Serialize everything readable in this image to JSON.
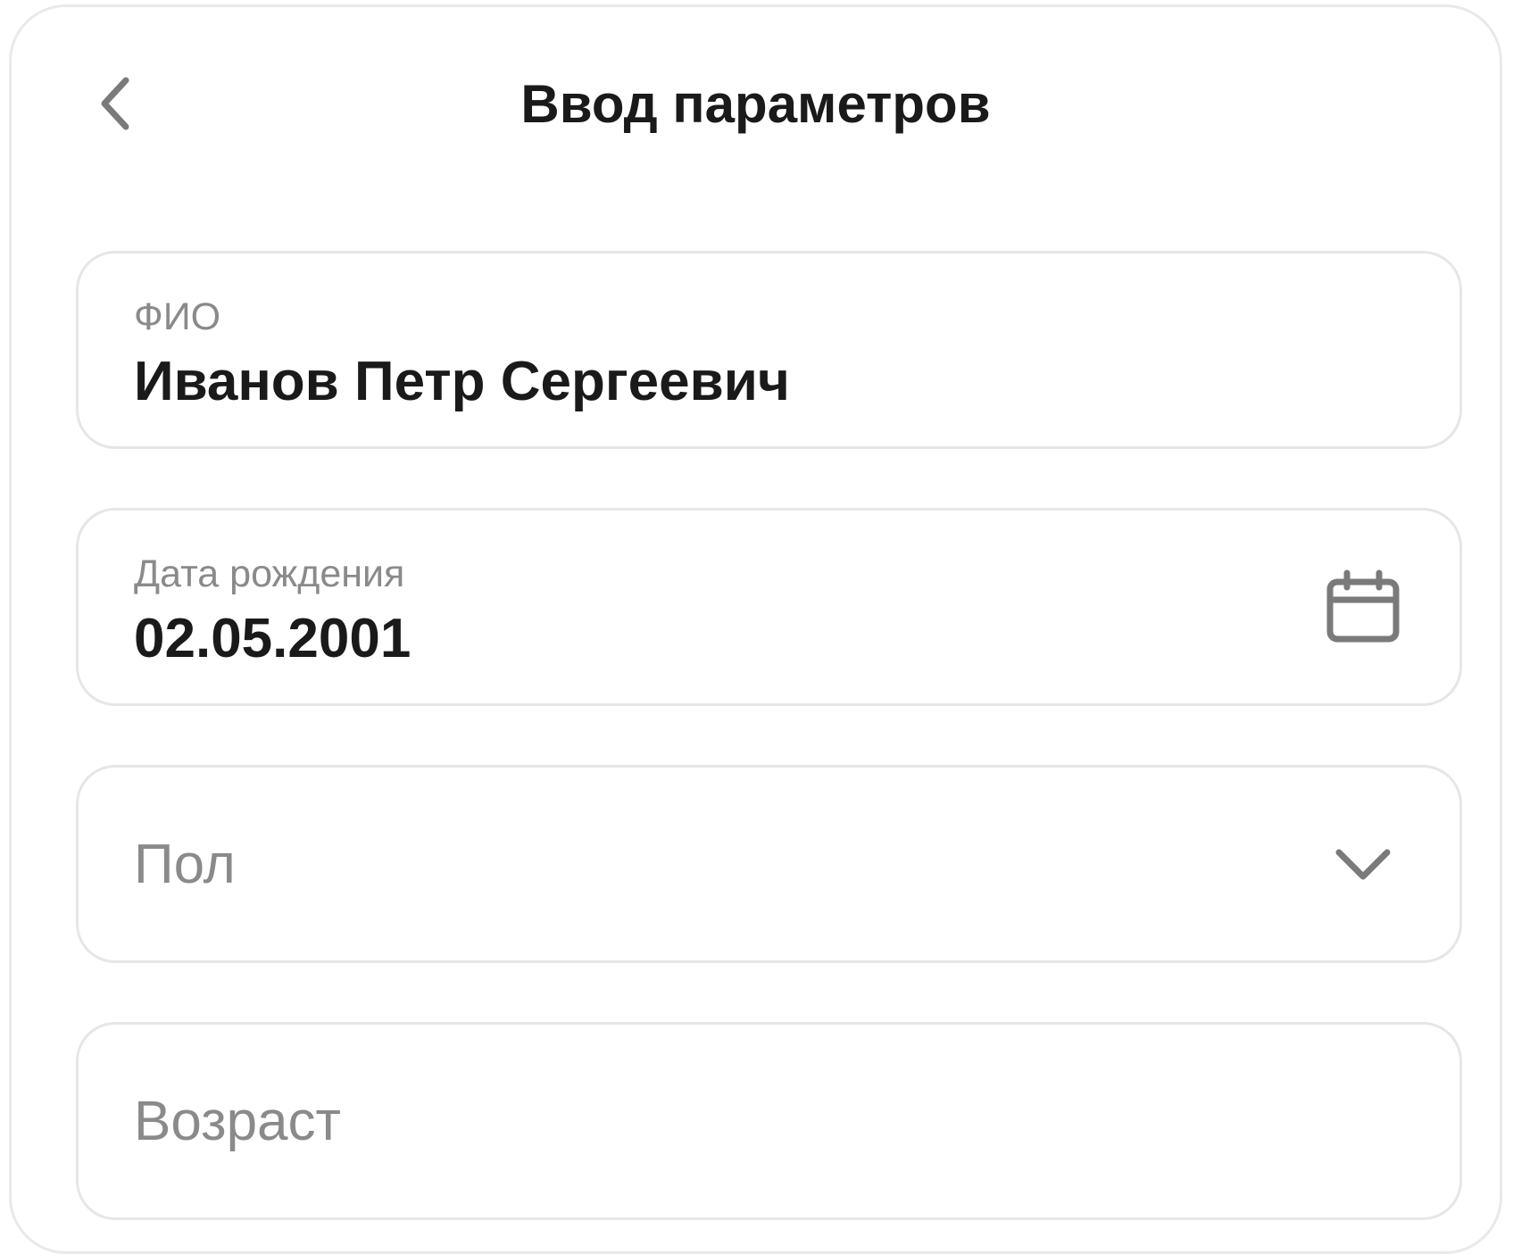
{
  "header": {
    "title": "Ввод параметров",
    "back_icon": "chevron-left-icon"
  },
  "form": {
    "full_name": {
      "label": "ФИО",
      "value": "Иванов Петр Сергеевич"
    },
    "birth_date": {
      "label": "Дата рождения",
      "value": "02.05.2001",
      "icon": "calendar-icon"
    },
    "gender": {
      "placeholder": "Пол",
      "icon": "chevron-down-icon"
    },
    "age": {
      "placeholder": "Возраст"
    }
  },
  "colors": {
    "text_primary": "#1a1a1a",
    "text_secondary": "#8a8a8a",
    "border": "#e6e6e6",
    "icon": "#7a7a7a"
  }
}
